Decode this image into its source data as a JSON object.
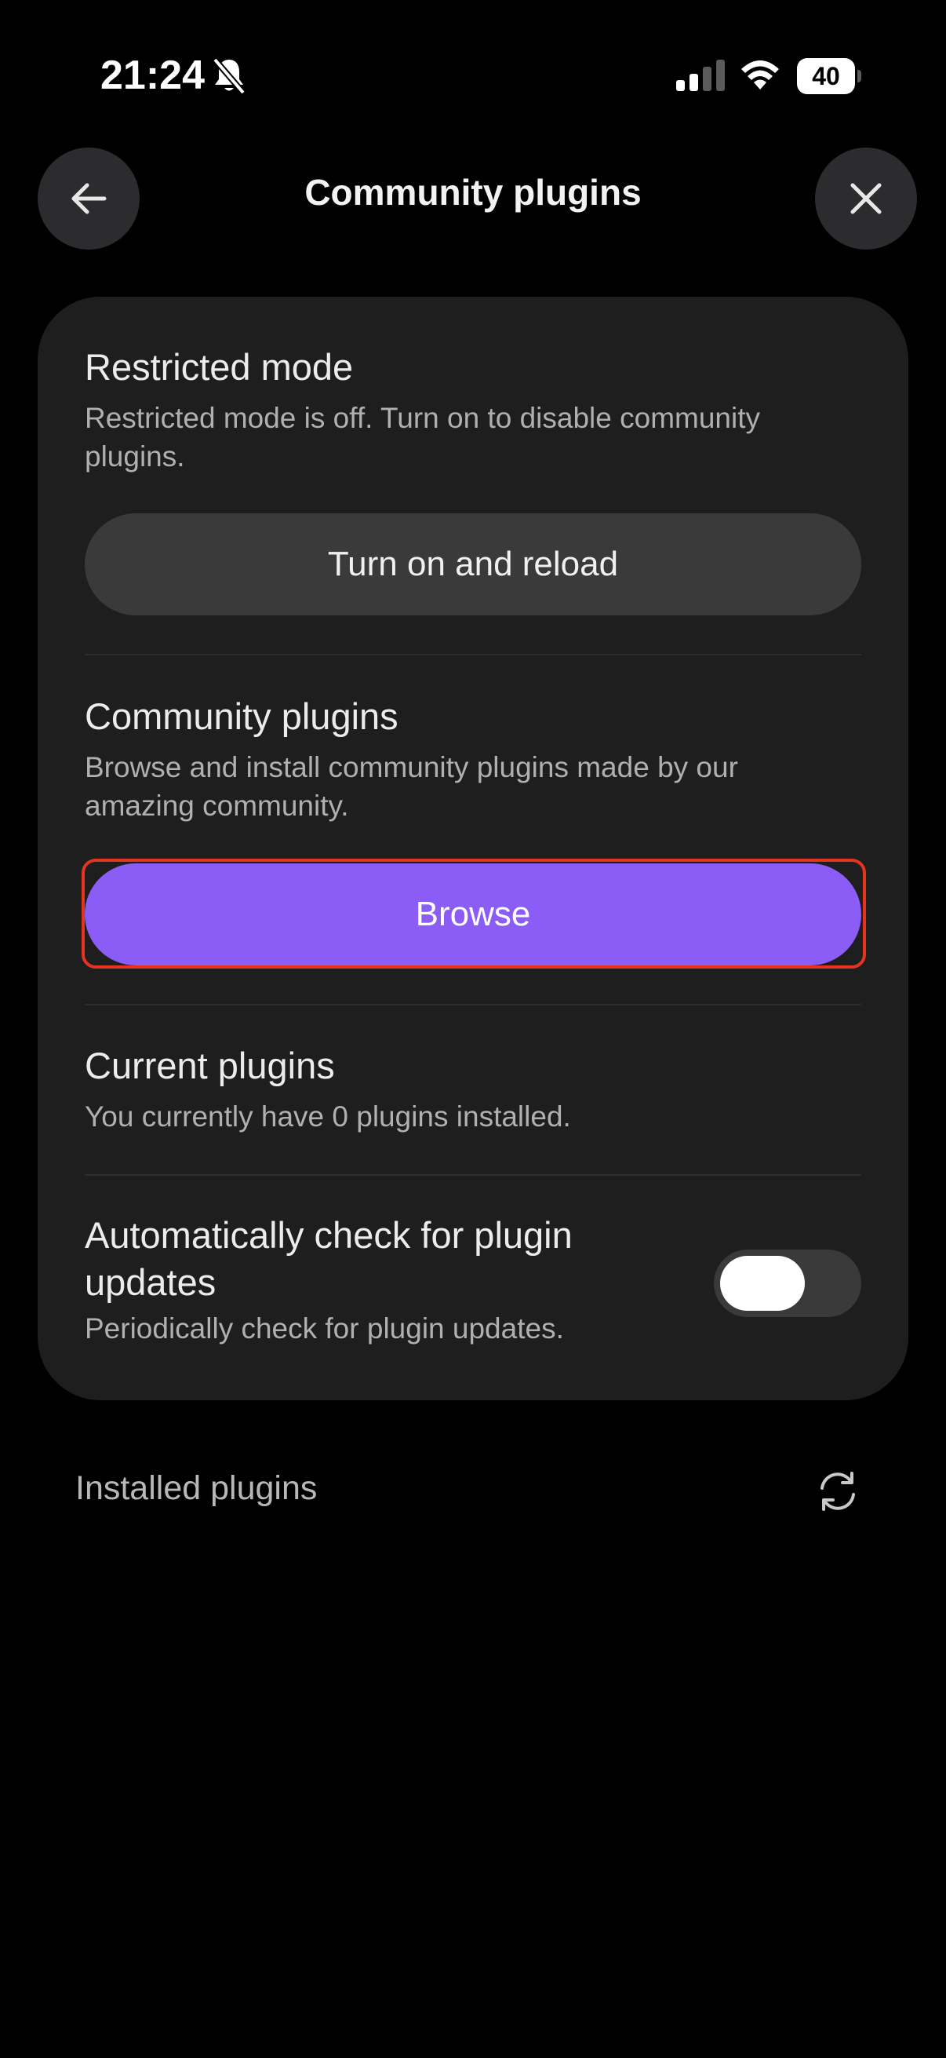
{
  "status_bar": {
    "time": "21:24",
    "battery": "40",
    "icons": [
      "bell-slash-icon",
      "signal-icon",
      "wifi-icon",
      "battery-icon"
    ]
  },
  "header": {
    "title": "Community plugins",
    "back_icon": "arrow-left-icon",
    "close_icon": "close-icon"
  },
  "restricted_mode": {
    "title": "Restricted mode",
    "description": "Restricted mode is off. Turn on to disable community plugins.",
    "button_label": "Turn on and reload"
  },
  "community_plugins": {
    "title": "Community plugins",
    "description": "Browse and install community plugins made by our amazing community.",
    "button_label": "Browse"
  },
  "current_plugins": {
    "title": "Current plugins",
    "description": "You currently have 0 plugins installed."
  },
  "auto_check": {
    "title": "Automatically check for plugin updates",
    "description": "Periodically check for plugin updates.",
    "enabled": false
  },
  "installed_plugins": {
    "label": "Installed plugins",
    "refresh_icon": "refresh-icon"
  },
  "colors": {
    "accent": "#8b5cf6",
    "highlight": "#e4341e",
    "card": "#1e1e1e",
    "background": "#000000"
  }
}
